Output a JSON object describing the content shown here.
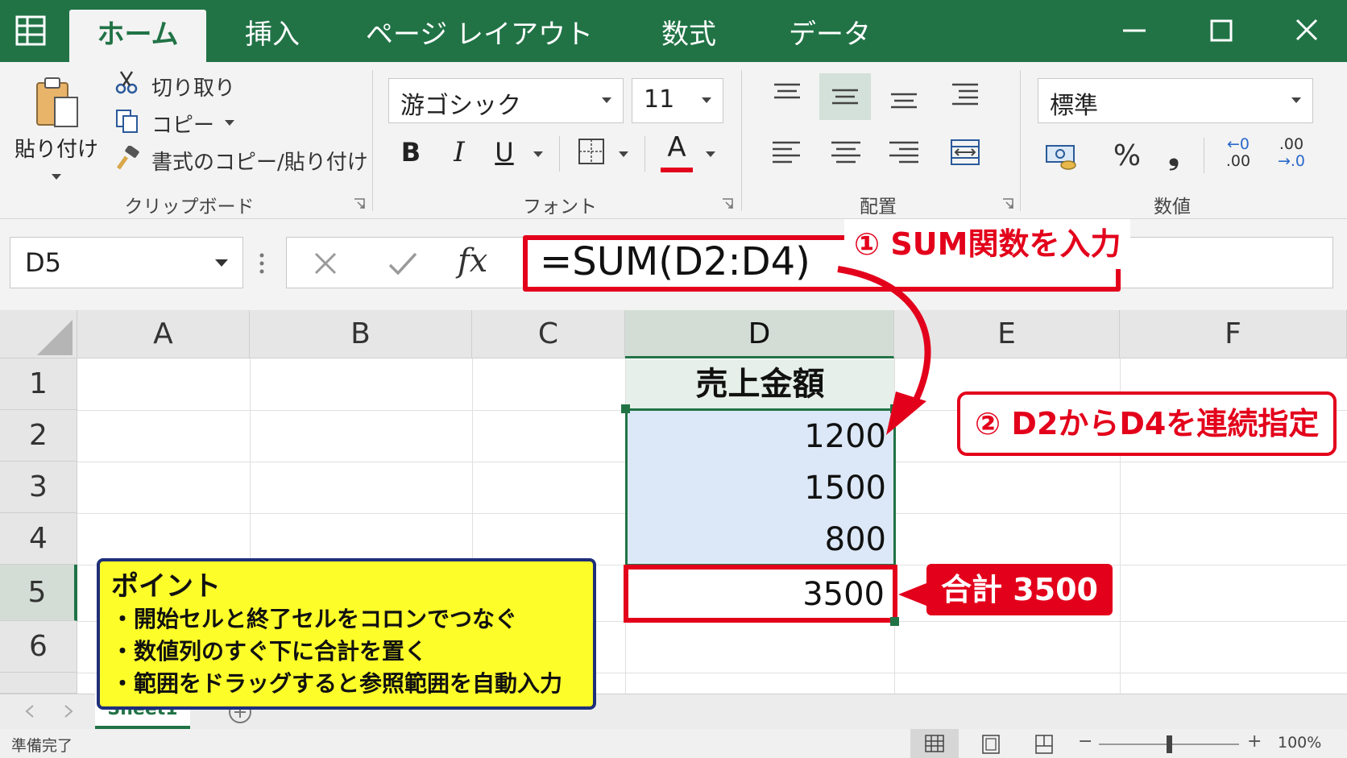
{
  "tabs": [
    "ホーム",
    "挿入",
    "ページ レイアウト",
    "数式",
    "データ"
  ],
  "clipboard": {
    "paste": "貼り付け",
    "cut": "切り取り",
    "copy": "コピー",
    "format_painter": "書式のコピー/貼り付け",
    "group": "クリップボード"
  },
  "font": {
    "name": "游ゴシック",
    "size": "11",
    "bold": "B",
    "italic": "I",
    "underline": "U",
    "color_letter": "A",
    "group": "フォント"
  },
  "alignment": {
    "group": "配置"
  },
  "number": {
    "format": "標準",
    "percent": "%",
    "comma": "❟",
    "inc_top": "←0",
    "inc_bottom": ".00",
    "dec_top": ".00",
    "dec_bottom": "→.0",
    "group": "数値"
  },
  "formula": {
    "name_box": "D5",
    "fx": "fx",
    "content": "=SUM(D2:D4)"
  },
  "columns": [
    "A",
    "B",
    "C",
    "D",
    "E",
    "F"
  ],
  "rows": [
    "1",
    "2",
    "3",
    "4",
    "5",
    "6"
  ],
  "cells": {
    "D1": "売上金額",
    "D2": "1200",
    "D3": "1500",
    "D4": "800",
    "D5": "3500"
  },
  "callouts": {
    "step1": "① SUM関数を入力",
    "step2": "② D2からD4を連続指定",
    "total": "合計 3500",
    "point_title": "ポイント",
    "point_items": [
      "・開始セルと終了セルをコロンでつなぐ",
      "・数値列のすぐ下に合計を置く",
      "・範囲をドラッグすると参照範囲を自動入力"
    ]
  },
  "sheet_tab": "Sheet1",
  "status": {
    "ready": "準備完了",
    "zoom": "100%"
  },
  "colors": {
    "excel_green": "#217346",
    "accent_red": "#e3001b",
    "note_yellow": "#fdfd2a",
    "note_border": "#1f2f7a"
  }
}
